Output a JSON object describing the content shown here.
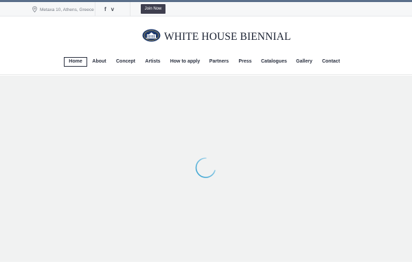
{
  "topbar": {
    "location_text": "Metaxa 10, Athens, Greece",
    "location_icon": "map-pin-icon",
    "social": [
      {
        "name": "facebook-icon",
        "glyph": "f"
      },
      {
        "name": "vimeo-icon",
        "glyph": "v"
      }
    ],
    "join_label": "Join Now"
  },
  "header": {
    "logo_text": "WHITE HOUSE BIENNIAL",
    "logo_icon": "white-house-seal-icon"
  },
  "nav": {
    "items": [
      {
        "label": "Home",
        "active": true
      },
      {
        "label": "About"
      },
      {
        "label": "Concept"
      },
      {
        "label": "Artists"
      },
      {
        "label": "How to apply"
      },
      {
        "label": "Partners"
      },
      {
        "label": "Press"
      },
      {
        "label": "Catalogues"
      },
      {
        "label": "Gallery"
      },
      {
        "label": "Contact"
      }
    ]
  },
  "main": {
    "loader_icon": "loading-spinner-icon"
  },
  "colors": {
    "accent_top": "#5a6f8a",
    "button_bg": "#3f3f4f",
    "content_bg": "#f1f2f2",
    "spinner": "#39a7d2"
  }
}
